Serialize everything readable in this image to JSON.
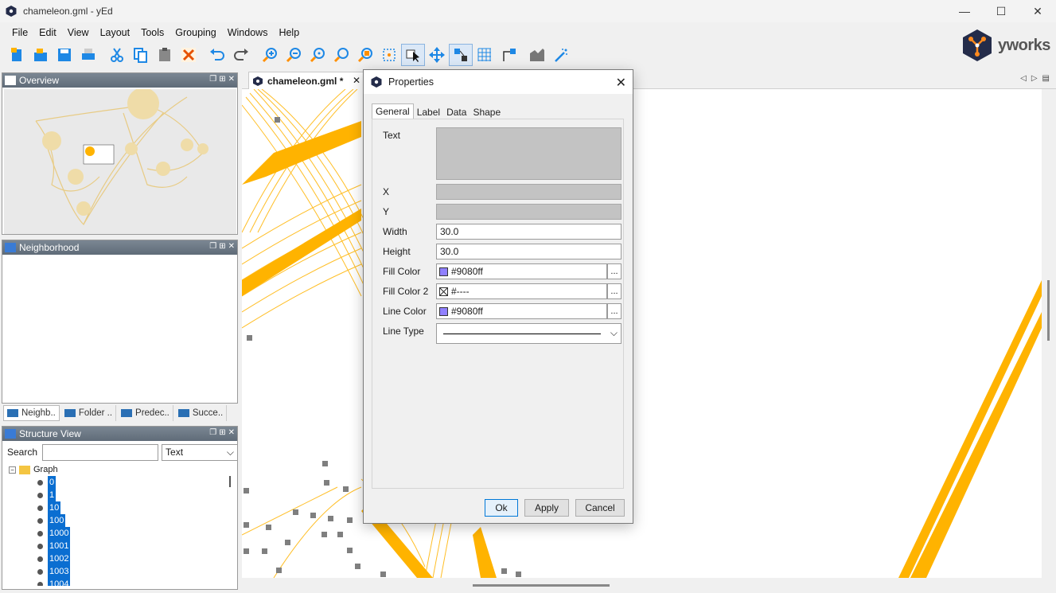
{
  "window": {
    "title": "chameleon.gml - yEd",
    "controls": [
      "—",
      "☐",
      "✕"
    ]
  },
  "menu": [
    "File",
    "Edit",
    "View",
    "Layout",
    "Tools",
    "Grouping",
    "Windows",
    "Help"
  ],
  "logo": {
    "word": "yworks"
  },
  "toolbar": {
    "icons": [
      "new-document-icon",
      "open-icon",
      "save-icon",
      "print-icon",
      "cut-icon",
      "copy-icon",
      "paste-icon",
      "delete-icon",
      "undo-icon",
      "redo-icon",
      "zoom-in-icon",
      "zoom-out-icon",
      "zoom-100-icon",
      "zoom-fit-icon",
      "zoom-area-icon",
      "fit-content-icon",
      "edit-mode-icon",
      "move-view-icon",
      "lasso-icon",
      "grid-icon",
      "orthogonal-edges-icon",
      "snap-icon",
      "magic-wand-icon"
    ]
  },
  "panels": {
    "overview": {
      "title": "Overview"
    },
    "neighborhood": {
      "title": "Neighborhood",
      "tabs": [
        "Neighb..",
        "Folder ..",
        "Predec..",
        "Succe.."
      ]
    },
    "structure": {
      "title": "Structure View",
      "search_label": "Search",
      "search_value": "",
      "filter_value": "Text",
      "root": "Graph",
      "items": [
        "0",
        "1",
        "10",
        "100",
        "1000",
        "1001",
        "1002",
        "1003",
        "1004"
      ]
    }
  },
  "document": {
    "tab_label": "chameleon.gml *",
    "close": "✕"
  },
  "dialog": {
    "title": "Properties",
    "tabs": [
      "General",
      "Label",
      "Data",
      "Shape"
    ],
    "active_tab": "General",
    "fields": {
      "text_label": "Text",
      "x_label": "X",
      "y_label": "Y",
      "width_label": "Width",
      "width_value": "30.0",
      "height_label": "Height",
      "height_value": "30.0",
      "fill_color_label": "Fill Color",
      "fill_color_value": "#9080ff",
      "fill_color2_label": "Fill Color 2",
      "fill_color2_value": "#----",
      "line_color_label": "Line Color",
      "line_color_value": "#9080ff",
      "line_type_label": "Line Type",
      "more": "..."
    },
    "buttons": {
      "ok": "Ok",
      "apply": "Apply",
      "cancel": "Cancel"
    }
  },
  "colors": {
    "accent": "#0a6ed1",
    "edge": "#ffb300",
    "node": "#7f7f7f",
    "swatch": "#9080ff"
  }
}
